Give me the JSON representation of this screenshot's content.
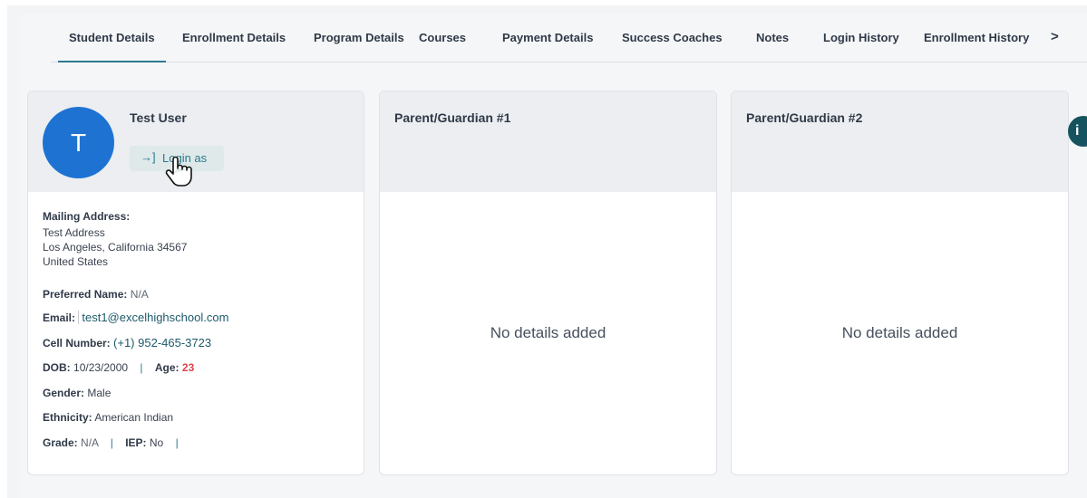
{
  "tabs": [
    {
      "label": "Student Details",
      "active": true
    },
    {
      "label": "Enrollment Details",
      "active": false
    },
    {
      "label": "Program Details",
      "active": false
    },
    {
      "label": "Courses",
      "active": false
    },
    {
      "label": "Payment Details",
      "active": false
    },
    {
      "label": "Success Coaches",
      "active": false
    },
    {
      "label": "Notes",
      "active": false
    },
    {
      "label": "Login History",
      "active": false
    },
    {
      "label": "Enrollment History",
      "active": false
    }
  ],
  "tabs_next_icon": ">",
  "student": {
    "avatar_letter": "T",
    "name": "Test User",
    "login_icon": "login-arrow-icon",
    "login_icon_glyph": "→]",
    "login_label": "Login as",
    "mailing_address_label": "Mailing Address:",
    "address_line1": "Test Address",
    "address_line2": "Los Angeles, California 34567",
    "address_line3": "United States",
    "preferred_name_label": "Preferred Name:",
    "preferred_name": "N/A",
    "email_label": "Email:",
    "email": "test1@excelhighschool.com",
    "cell_label": "Cell Number:",
    "cell": "(+1) 952-465-3723",
    "dob_label": "DOB:",
    "dob": "10/23/2000",
    "age_label": "Age:",
    "age": "23",
    "gender_label": "Gender:",
    "gender": "Male",
    "ethnicity_label": "Ethnicity:",
    "ethnicity": "American Indian",
    "grade_label": "Grade:",
    "grade": "N/A",
    "iep_label": "IEP:",
    "iep": "No"
  },
  "guardian1": {
    "title": "Parent/Guardian #1",
    "empty": "No details added"
  },
  "guardian2": {
    "title": "Parent/Guardian #2",
    "empty": "No details added"
  },
  "colors": {
    "accent": "#2b7a8c",
    "avatar": "#1e73d2",
    "age": "#e0444b",
    "help": "#17535f"
  }
}
